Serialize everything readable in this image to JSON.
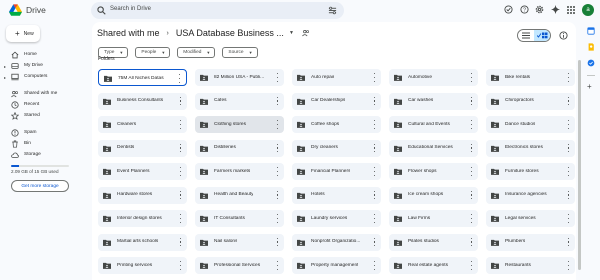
{
  "header": {
    "app_name": "Drive",
    "search_placeholder": "Search in Drive",
    "avatar_letter": "a"
  },
  "sidebar": {
    "new_label": "New",
    "items": [
      {
        "label": "Home",
        "icon": "home-icon",
        "arrow": false
      },
      {
        "label": "My Drive",
        "icon": "my-drive-icon",
        "arrow": true
      },
      {
        "label": "Computers",
        "icon": "computer-icon",
        "arrow": true
      },
      {
        "label": "Shared with me",
        "icon": "people-icon",
        "arrow": false
      },
      {
        "label": "Recent",
        "icon": "clock-icon",
        "arrow": false
      },
      {
        "label": "Starred",
        "icon": "star-icon",
        "arrow": false
      },
      {
        "label": "Spam",
        "icon": "spam-icon",
        "arrow": false
      },
      {
        "label": "Bin",
        "icon": "bin-icon",
        "arrow": false
      },
      {
        "label": "Storage",
        "icon": "cloud-icon",
        "arrow": false
      }
    ],
    "storage_text": "2.09 GB of 15 GB used",
    "storage_used_fraction": 0.14,
    "get_storage_label": "Get more storage"
  },
  "main": {
    "breadcrumb_root": "Shared with me",
    "breadcrumb_current": "USA Database Business ...",
    "filters": [
      "Type",
      "People",
      "Modified",
      "Source"
    ],
    "section_label": "Folders",
    "folders": [
      "75M All Niches Datas",
      "82 Million USA - Publi...",
      "Auto repair",
      "Automotive",
      "Bike rentals",
      "Business Consultants",
      "Cafes",
      "Car Dealerships",
      "Car washes",
      "Chiropractors",
      "Cleaners",
      "Clothing stores",
      "Coffee shops",
      "Cultural and Events",
      "Dance studios",
      "Dentists",
      "Distilleries",
      "Dry cleaners",
      "Educational Services",
      "Electronics stores",
      "Event Planners",
      "Farmers markets",
      "Financial Planners",
      "Flower shops",
      "Furniture stores",
      "Hardware stores",
      "Health and Beauty",
      "Hotels",
      "Ice cream shops",
      "Insurance agencies",
      "Interior design stores",
      "IT Consultants",
      "Laundry services",
      "Law Firms",
      "Legal services",
      "Martial arts schools",
      "Nail salons",
      "Nonprofit Organizatio...",
      "Pilates studios",
      "Plumbers",
      "Printing services",
      "Professional Services",
      "Property management",
      "Real estate agents",
      "Restaurants"
    ],
    "selected_index": 0,
    "hovered_index": 11
  },
  "colors": {
    "accent": "#0b57d0",
    "card_bg": "#f0f4f9",
    "page_bg": "#f8fafd"
  }
}
